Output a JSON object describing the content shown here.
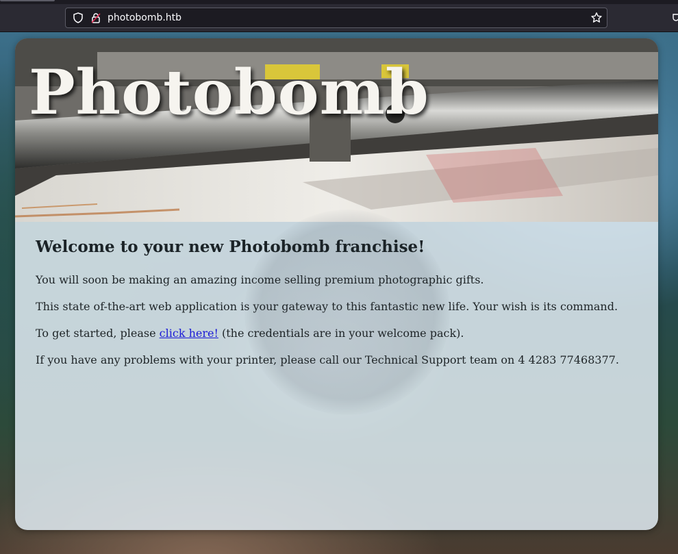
{
  "browser": {
    "url": "photobomb.htb",
    "icons": {
      "shield": "shield-icon",
      "lock": "lock-icon",
      "bookmark": "star-icon"
    }
  },
  "banner": {
    "title": "Photobomb"
  },
  "main": {
    "heading": "Welcome to your new Photobomb franchise!",
    "line1": "You will soon be making an amazing income selling premium photographic gifts.",
    "line2": "This state of-the-art web application is your gateway to this fantastic new life. Your wish is its command.",
    "line3_before": "To get started, please ",
    "line3_link": "click here!",
    "line3_after": " (the credentials are in your welcome pack).",
    "line4": "If you have any problems with your printer, please call our Technical Support team on 4 4283 77468377."
  },
  "colors": {
    "link": "#1a1ad6",
    "chrome_bg": "#2b2a33",
    "urlbar_bg": "#1c1b22"
  }
}
